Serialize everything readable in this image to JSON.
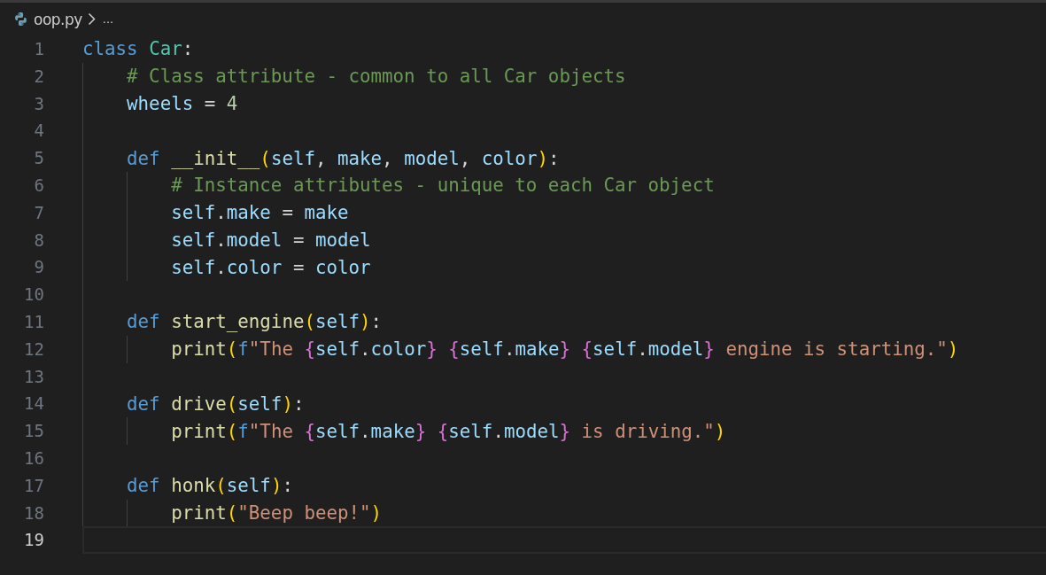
{
  "breadcrumb": {
    "file": "oop.py",
    "more": "..."
  },
  "lines": [
    {
      "number": "1",
      "current": false,
      "tokens": [
        {
          "kind": "keyword",
          "text": "class"
        },
        {
          "kind": "class",
          "text": " Car"
        },
        {
          "kind": "plain",
          "text": ":"
        }
      ]
    },
    {
      "number": "2",
      "current": false,
      "tokens": [
        {
          "kind": "comment",
          "text": "    # Class attribute - common to all Car objects"
        }
      ]
    },
    {
      "number": "3",
      "current": false,
      "tokens": [
        {
          "kind": "variable",
          "text": "    wheels"
        },
        {
          "kind": "plain",
          "text": " = "
        },
        {
          "kind": "number",
          "text": "4"
        }
      ]
    },
    {
      "number": "4",
      "current": false
    },
    {
      "number": "5",
      "current": false,
      "tokens": [
        {
          "kind": "keyword",
          "text": "    def"
        },
        {
          "kind": "function",
          "text": " __init__"
        },
        {
          "kind": "paren",
          "text": "("
        },
        {
          "kind": "variable",
          "text": "self"
        },
        {
          "kind": "plain",
          "text": ", "
        },
        {
          "kind": "variable",
          "text": "make"
        },
        {
          "kind": "plain",
          "text": ", "
        },
        {
          "kind": "variable",
          "text": "model"
        },
        {
          "kind": "plain",
          "text": ", "
        },
        {
          "kind": "variable",
          "text": "color"
        },
        {
          "kind": "paren",
          "text": ")"
        },
        {
          "kind": "plain",
          "text": ":"
        }
      ]
    },
    {
      "number": "6",
      "current": false,
      "tokens": [
        {
          "kind": "comment",
          "text": "        # Instance attributes - unique to each Car object"
        }
      ]
    },
    {
      "number": "7",
      "current": false,
      "tokens": [
        {
          "kind": "variable",
          "text": "        self"
        },
        {
          "kind": "plain",
          "text": "."
        },
        {
          "kind": "variable",
          "text": "make"
        },
        {
          "kind": "plain",
          "text": " = "
        },
        {
          "kind": "variable",
          "text": "make"
        }
      ]
    },
    {
      "number": "8",
      "current": false,
      "tokens": [
        {
          "kind": "variable",
          "text": "        self"
        },
        {
          "kind": "plain",
          "text": "."
        },
        {
          "kind": "variable",
          "text": "model"
        },
        {
          "kind": "plain",
          "text": " = "
        },
        {
          "kind": "variable",
          "text": "model"
        }
      ]
    },
    {
      "number": "9",
      "current": false,
      "tokens": [
        {
          "kind": "variable",
          "text": "        self"
        },
        {
          "kind": "plain",
          "text": "."
        },
        {
          "kind": "variable",
          "text": "color"
        },
        {
          "kind": "plain",
          "text": " = "
        },
        {
          "kind": "variable",
          "text": "color"
        }
      ]
    },
    {
      "number": "10",
      "current": false
    },
    {
      "number": "11",
      "current": false,
      "tokens": [
        {
          "kind": "keyword",
          "text": "    def"
        },
        {
          "kind": "function",
          "text": " start_engine"
        },
        {
          "kind": "paren",
          "text": "("
        },
        {
          "kind": "variable",
          "text": "self"
        },
        {
          "kind": "paren",
          "text": ")"
        },
        {
          "kind": "plain",
          "text": ":"
        }
      ]
    },
    {
      "number": "12",
      "current": false,
      "tokens": [
        {
          "kind": "function",
          "text": "        print"
        },
        {
          "kind": "paren",
          "text": "("
        },
        {
          "kind": "keyword",
          "text": "f"
        },
        {
          "kind": "string",
          "text": "\"The "
        },
        {
          "kind": "brace",
          "text": "{"
        },
        {
          "kind": "variable",
          "text": "self"
        },
        {
          "kind": "plain",
          "text": "."
        },
        {
          "kind": "variable",
          "text": "color"
        },
        {
          "kind": "brace",
          "text": "}"
        },
        {
          "kind": "brace",
          "text": " {"
        },
        {
          "kind": "variable",
          "text": "self"
        },
        {
          "kind": "plain",
          "text": "."
        },
        {
          "kind": "variable",
          "text": "make"
        },
        {
          "kind": "brace",
          "text": "}"
        },
        {
          "kind": "brace",
          "text": " {"
        },
        {
          "kind": "variable",
          "text": "self"
        },
        {
          "kind": "plain",
          "text": "."
        },
        {
          "kind": "variable",
          "text": "model"
        },
        {
          "kind": "brace",
          "text": "}"
        },
        {
          "kind": "string",
          "text": " engine is starting.\""
        },
        {
          "kind": "paren",
          "text": ")"
        }
      ]
    },
    {
      "number": "13",
      "current": false
    },
    {
      "number": "14",
      "current": false,
      "tokens": [
        {
          "kind": "keyword",
          "text": "    def"
        },
        {
          "kind": "function",
          "text": " drive"
        },
        {
          "kind": "paren",
          "text": "("
        },
        {
          "kind": "variable",
          "text": "self"
        },
        {
          "kind": "paren",
          "text": ")"
        },
        {
          "kind": "plain",
          "text": ":"
        }
      ]
    },
    {
      "number": "15",
      "current": false,
      "tokens": [
        {
          "kind": "function",
          "text": "        print"
        },
        {
          "kind": "paren",
          "text": "("
        },
        {
          "kind": "keyword",
          "text": "f"
        },
        {
          "kind": "string",
          "text": "\"The "
        },
        {
          "kind": "brace",
          "text": "{"
        },
        {
          "kind": "variable",
          "text": "self"
        },
        {
          "kind": "plain",
          "text": "."
        },
        {
          "kind": "variable",
          "text": "make"
        },
        {
          "kind": "brace",
          "text": "}"
        },
        {
          "kind": "brace",
          "text": " {"
        },
        {
          "kind": "variable",
          "text": "self"
        },
        {
          "kind": "plain",
          "text": "."
        },
        {
          "kind": "variable",
          "text": "model"
        },
        {
          "kind": "brace",
          "text": "}"
        },
        {
          "kind": "string",
          "text": " is driving.\""
        },
        {
          "kind": "paren",
          "text": ")"
        }
      ]
    },
    {
      "number": "16",
      "current": false
    },
    {
      "number": "17",
      "current": false,
      "tokens": [
        {
          "kind": "keyword",
          "text": "    def"
        },
        {
          "kind": "function",
          "text": " honk"
        },
        {
          "kind": "paren",
          "text": "("
        },
        {
          "kind": "variable",
          "text": "self"
        },
        {
          "kind": "paren",
          "text": ")"
        },
        {
          "kind": "plain",
          "text": ":"
        }
      ]
    },
    {
      "number": "18",
      "current": false,
      "tokens": [
        {
          "kind": "function",
          "text": "        print"
        },
        {
          "kind": "paren",
          "text": "("
        },
        {
          "kind": "string",
          "text": "\"Beep beep!\""
        },
        {
          "kind": "paren",
          "text": ")"
        }
      ]
    },
    {
      "number": "19",
      "current": true
    }
  ]
}
